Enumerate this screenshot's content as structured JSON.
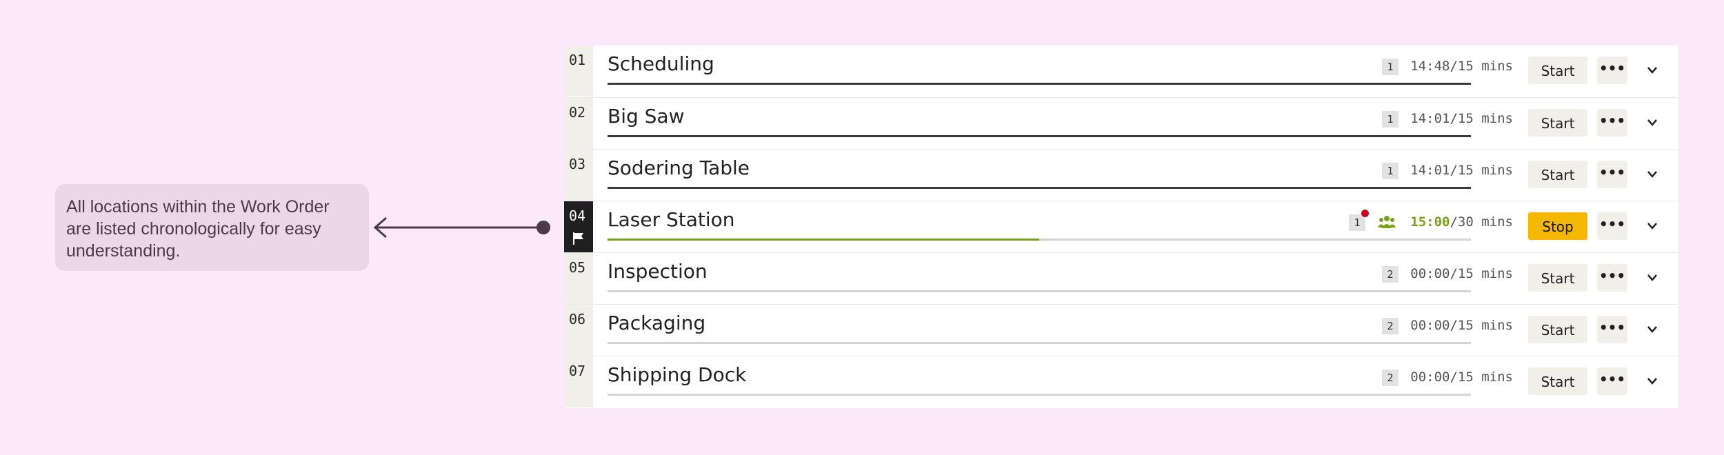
{
  "callout": {
    "text": "All locations within the Work Order are listed chronologically for easy understanding."
  },
  "colors": {
    "page_background": "#fbe8fb",
    "callout_background": "#ead7ea",
    "active_progress": "#77a314",
    "stop_button": "#f5b800",
    "notification_dot": "#d0021b"
  },
  "icons": {
    "active_marker": "flag-icon",
    "crew": "people-icon",
    "more": "ellipsis-icon",
    "expand": "chevron-down-icon"
  },
  "rows": [
    {
      "number": "01",
      "name": "Scheduling",
      "qty": "1",
      "time_elapsed": "14:48",
      "time_total": "/15 mins",
      "action": "Start",
      "progress": 1.0
    },
    {
      "number": "02",
      "name": "Big Saw",
      "qty": "1",
      "time_elapsed": "14:01",
      "time_total": "/15 mins",
      "action": "Start",
      "progress": 1.0
    },
    {
      "number": "03",
      "name": "Sodering Table",
      "qty": "1",
      "time_elapsed": "14:01",
      "time_total": "/15 mins",
      "action": "Start",
      "progress": 1.0
    },
    {
      "number": "04",
      "name": "Laser Station",
      "qty": "1",
      "time_elapsed": "15:00",
      "time_total": "/30 mins",
      "action": "Stop",
      "progress": 0.5,
      "active": true
    },
    {
      "number": "05",
      "name": "Inspection",
      "qty": "2",
      "time_elapsed": "00:00",
      "time_total": "/15 mins",
      "action": "Start",
      "progress": 0.0
    },
    {
      "number": "06",
      "name": "Packaging",
      "qty": "2",
      "time_elapsed": "00:00",
      "time_total": "/15 mins",
      "action": "Start",
      "progress": 0.0
    },
    {
      "number": "07",
      "name": "Shipping Dock",
      "qty": "2",
      "time_elapsed": "00:00",
      "time_total": "/15 mins",
      "action": "Start",
      "progress": 0.0
    }
  ],
  "more_glyph": "•••"
}
